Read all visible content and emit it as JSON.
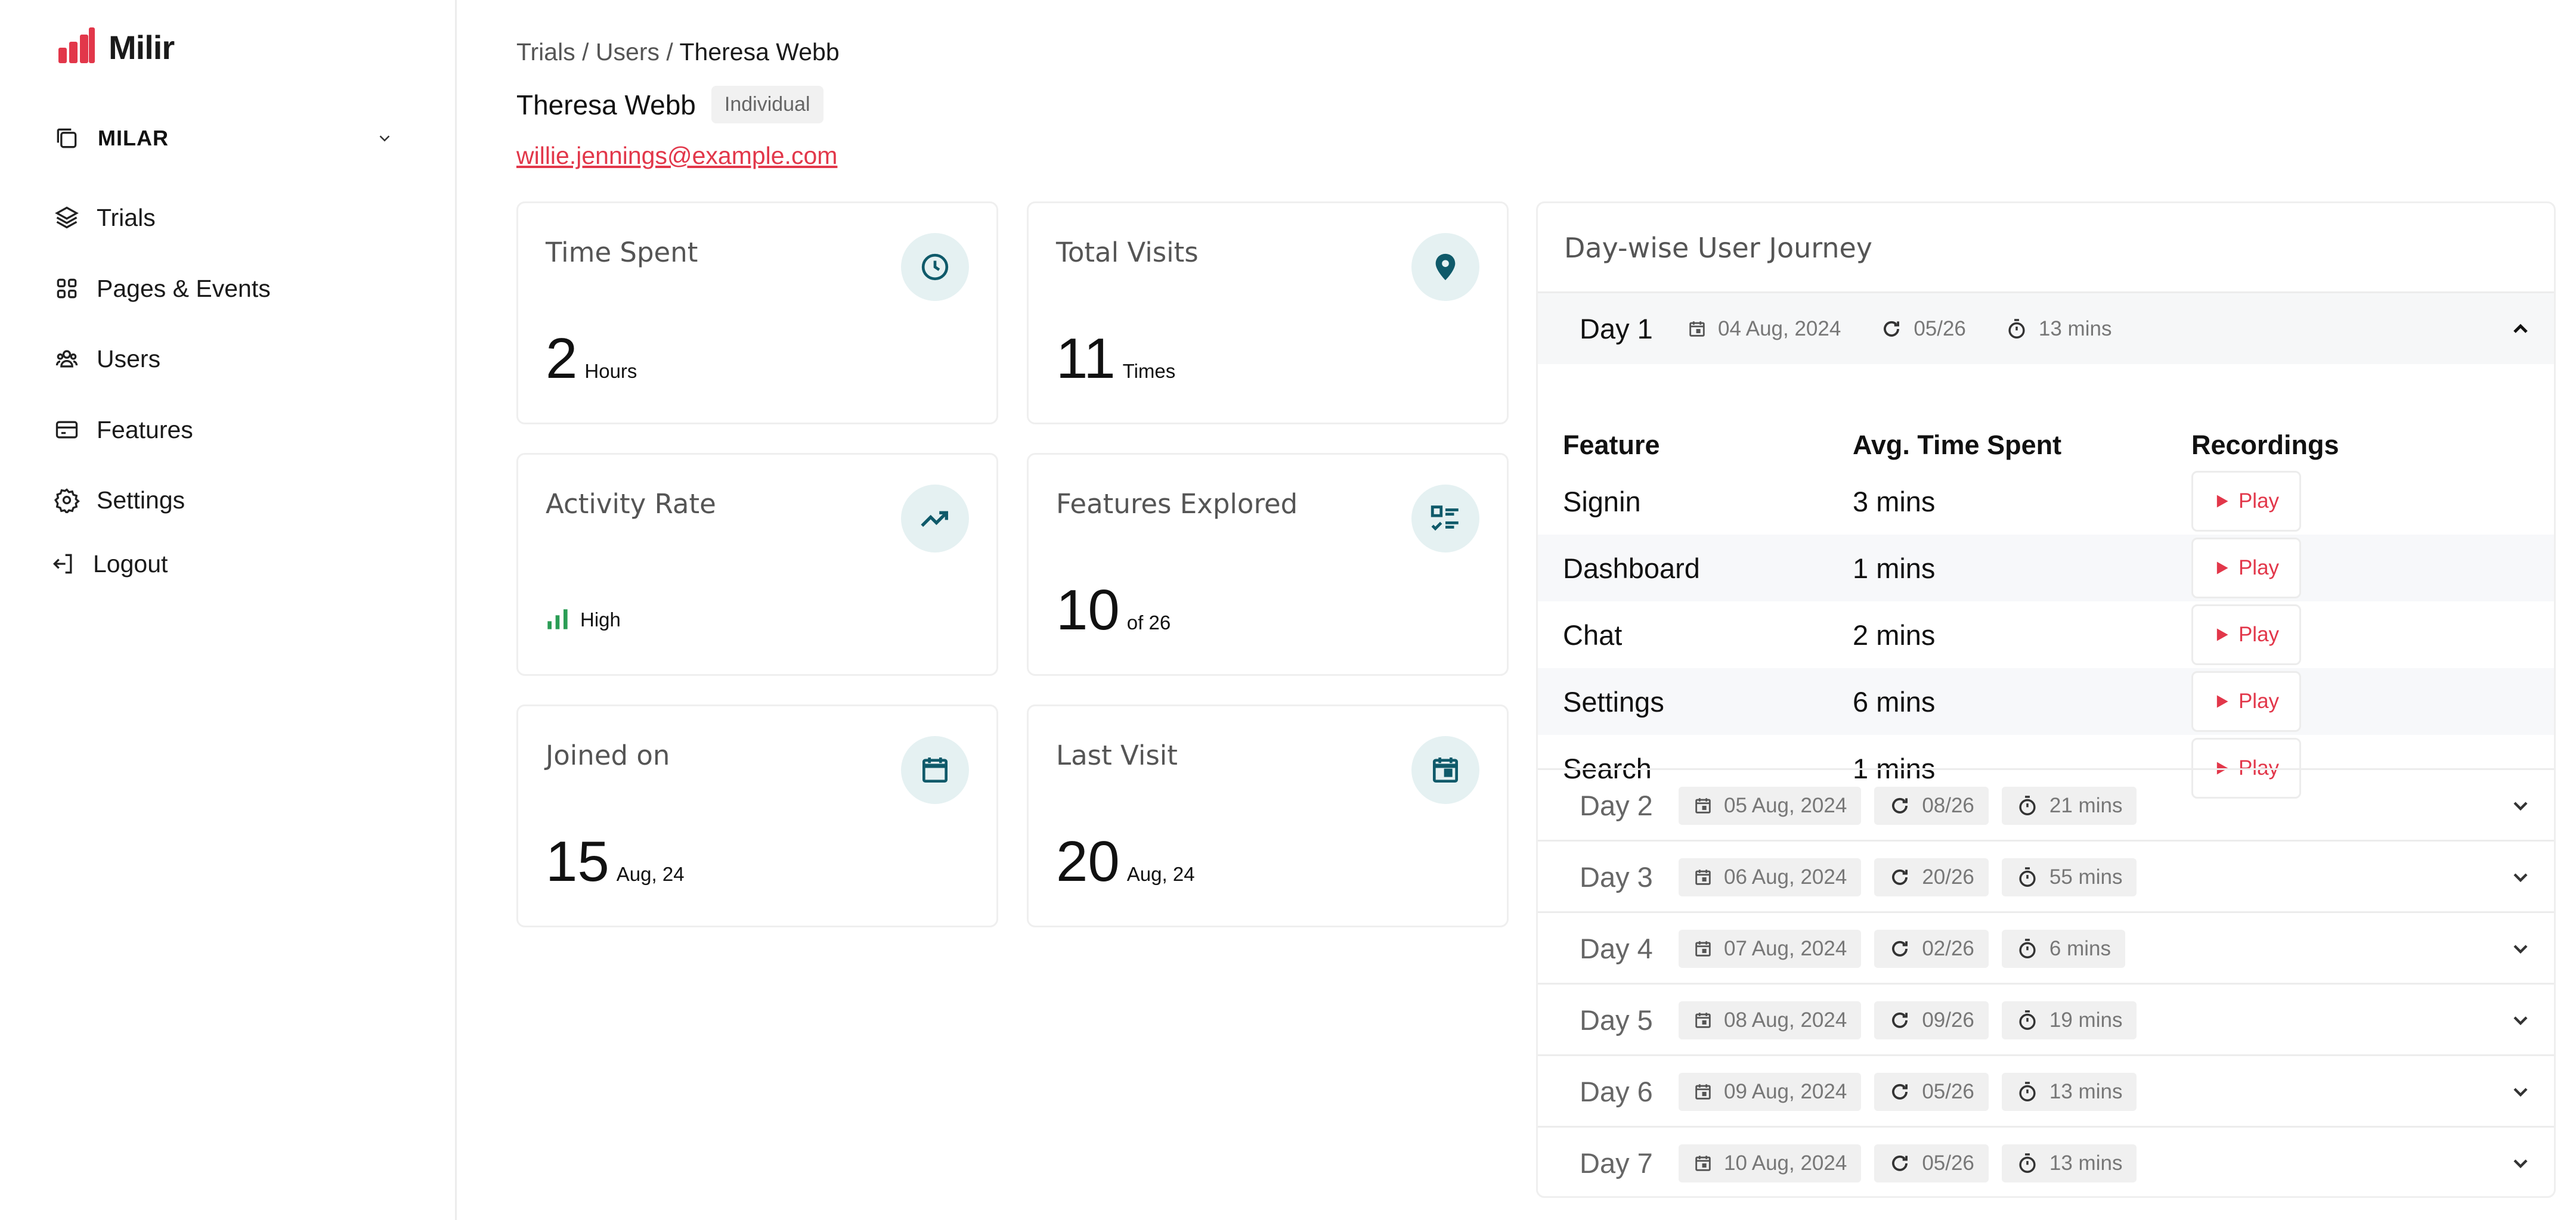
{
  "app": {
    "brand": "Milir",
    "brand_color": "#e2374a",
    "workspace": "MILAR"
  },
  "sidebar": {
    "items": [
      {
        "label": "Trials",
        "icon": "layers-icon"
      },
      {
        "label": "Pages & Events",
        "icon": "grid-icon"
      },
      {
        "label": "Users",
        "icon": "users-icon"
      },
      {
        "label": "Features",
        "icon": "card-icon"
      },
      {
        "label": "Settings",
        "icon": "gear-icon"
      },
      {
        "label": "Logout",
        "icon": "logout-icon"
      }
    ]
  },
  "breadcrumb": {
    "items": [
      "Trials",
      "Users"
    ],
    "separator": "/",
    "current": "Theresa Webb"
  },
  "user": {
    "name": "Theresa Webb",
    "type": "Individual",
    "email": "willie.jennings@example.com"
  },
  "stats": {
    "time_spent": {
      "title": "Time Spent",
      "value": "2",
      "unit": "Hours",
      "icon": "clock-icon"
    },
    "total_visits": {
      "title": "Total Visits",
      "value": "11",
      "unit": "Times",
      "icon": "location-pin-icon"
    },
    "activity_rate": {
      "title": "Activity Rate",
      "value": "High",
      "icon": "trending-up-icon"
    },
    "features_explored": {
      "title": "Features Explored",
      "value": "10",
      "unit": "of 26",
      "icon": "checklist-icon"
    },
    "joined_on": {
      "title": "Joined on",
      "value": "15",
      "unit": "Aug, 24",
      "icon": "calendar-icon"
    },
    "last_visit": {
      "title": "Last Visit",
      "value": "20",
      "unit": "Aug, 24",
      "icon": "calendar-event-icon"
    }
  },
  "journey": {
    "title": "Day-wise User Journey",
    "columns": [
      "Feature",
      "Avg. Time Spent",
      "Recordings"
    ],
    "play_label": "Play",
    "days": [
      {
        "label": "Day 1",
        "date": "04 Aug, 2024",
        "features": "05/26",
        "duration": "13 mins",
        "expanded": true,
        "rows": [
          {
            "feature": "Signin",
            "time": "3 mins"
          },
          {
            "feature": "Dashboard",
            "time": "1 mins"
          },
          {
            "feature": "Chat",
            "time": "2 mins"
          },
          {
            "feature": "Settings",
            "time": "6 mins"
          },
          {
            "feature": "Search",
            "time": "1 mins"
          }
        ]
      },
      {
        "label": "Day 2",
        "date": "05 Aug, 2024",
        "features": "08/26",
        "duration": "21 mins",
        "expanded": false
      },
      {
        "label": "Day 3",
        "date": "06 Aug, 2024",
        "features": "20/26",
        "duration": "55 mins",
        "expanded": false
      },
      {
        "label": "Day 4",
        "date": "07 Aug, 2024",
        "features": "02/26",
        "duration": "6 mins",
        "expanded": false
      },
      {
        "label": "Day 5",
        "date": "08 Aug, 2024",
        "features": "09/26",
        "duration": "19 mins",
        "expanded": false
      },
      {
        "label": "Day 6",
        "date": "09 Aug, 2024",
        "features": "05/26",
        "duration": "13 mins",
        "expanded": false
      },
      {
        "label": "Day 7",
        "date": "10 Aug, 2024",
        "features": "05/26",
        "duration": "13 mins",
        "expanded": false
      }
    ]
  },
  "colors": {
    "accent": "#e2374a",
    "icon_teal": "#0f5a6a",
    "icon_bg": "#e5f1f2",
    "activity_green": "#2a9d55"
  }
}
